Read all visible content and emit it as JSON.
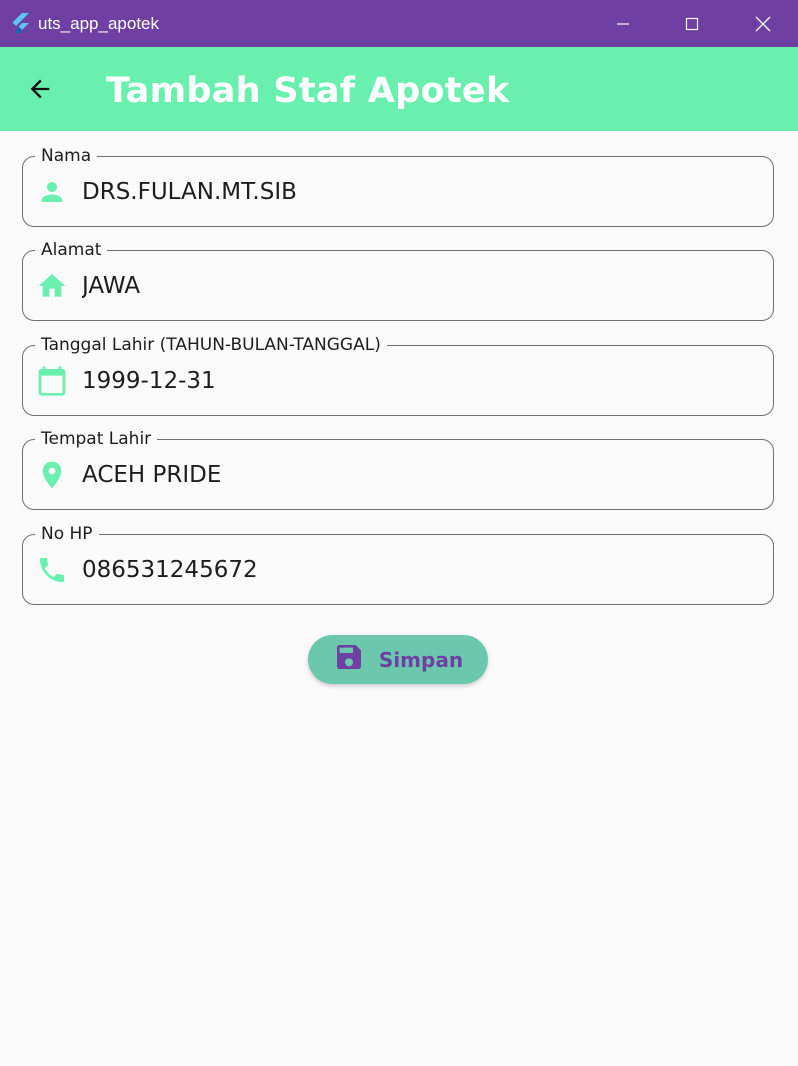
{
  "window": {
    "title": "uts_app_apotek",
    "icon": "flutter-logo-icon"
  },
  "appbar": {
    "title": "Tambah Staf Apotek",
    "back_icon": "arrow-back-icon"
  },
  "form": {
    "fields": [
      {
        "label": "Nama",
        "value": "DRS.FULAN.MT.SIB",
        "icon": "person-icon"
      },
      {
        "label": "Alamat",
        "value": "JAWA",
        "icon": "home-icon"
      },
      {
        "label": "Tanggal Lahir (TAHUN-BULAN-TANGGAL)",
        "value": "1999-12-31",
        "icon": "calendar-icon"
      },
      {
        "label": "Tempat Lahir",
        "value": "ACEH PRIDE",
        "icon": "location-pin-icon"
      },
      {
        "label": "No HP",
        "value": "086531245672",
        "icon": "phone-icon"
      }
    ]
  },
  "save_button": {
    "label": "Simpan",
    "icon": "save-icon"
  },
  "colors": {
    "titlebar": "#6f3fa3",
    "appbar": "#69f0ae",
    "icon": "#69f0ae",
    "button": "#6bc8ad",
    "button_text": "#6f3fa3"
  }
}
